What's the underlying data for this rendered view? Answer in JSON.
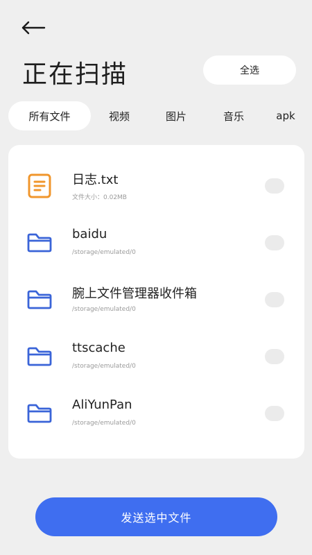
{
  "header": {
    "back_icon": "arrow-left-icon",
    "title": "正在扫描",
    "select_all_label": "全选"
  },
  "tabs": [
    {
      "label": "所有文件",
      "active": true
    },
    {
      "label": "视频",
      "active": false
    },
    {
      "label": "图片",
      "active": false
    },
    {
      "label": "音乐",
      "active": false
    },
    {
      "label": "apk",
      "active": false
    }
  ],
  "files": [
    {
      "name": "日志.txt",
      "sub": "文件大小：0.02MB",
      "icon": "text-file-icon",
      "selected": false
    },
    {
      "name": "baidu",
      "sub": "/storage/emulated/0",
      "icon": "folder-icon",
      "selected": false
    },
    {
      "name": "腕上文件管理器收件箱",
      "sub": "/storage/emulated/0",
      "icon": "folder-icon",
      "selected": false
    },
    {
      "name": "ttscache",
      "sub": "/storage/emulated/0",
      "icon": "folder-icon",
      "selected": false
    },
    {
      "name": "AliYunPan",
      "sub": "/storage/emulated/0",
      "icon": "folder-icon",
      "selected": false
    }
  ],
  "footer": {
    "send_label": "发送选中文件"
  },
  "colors": {
    "accent": "#3f6ef0",
    "folder": "#3a64d8",
    "text_file": "#f0962c",
    "background": "#efefef"
  }
}
